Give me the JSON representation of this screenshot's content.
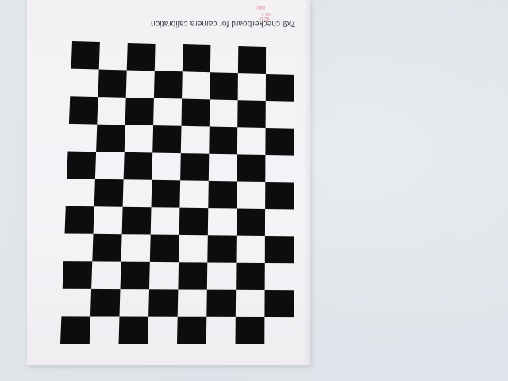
{
  "scene": {
    "caption": "7x9 checkerboard for camera calibration",
    "marks": [
      "(cm)",
      "30.0",
      "42.0"
    ]
  },
  "checkerboard": {
    "columns": 8,
    "rows": 11,
    "square_color": "#0d0d10",
    "paper_color": "#f4f2f5",
    "background_color": "#dfe4e9"
  }
}
